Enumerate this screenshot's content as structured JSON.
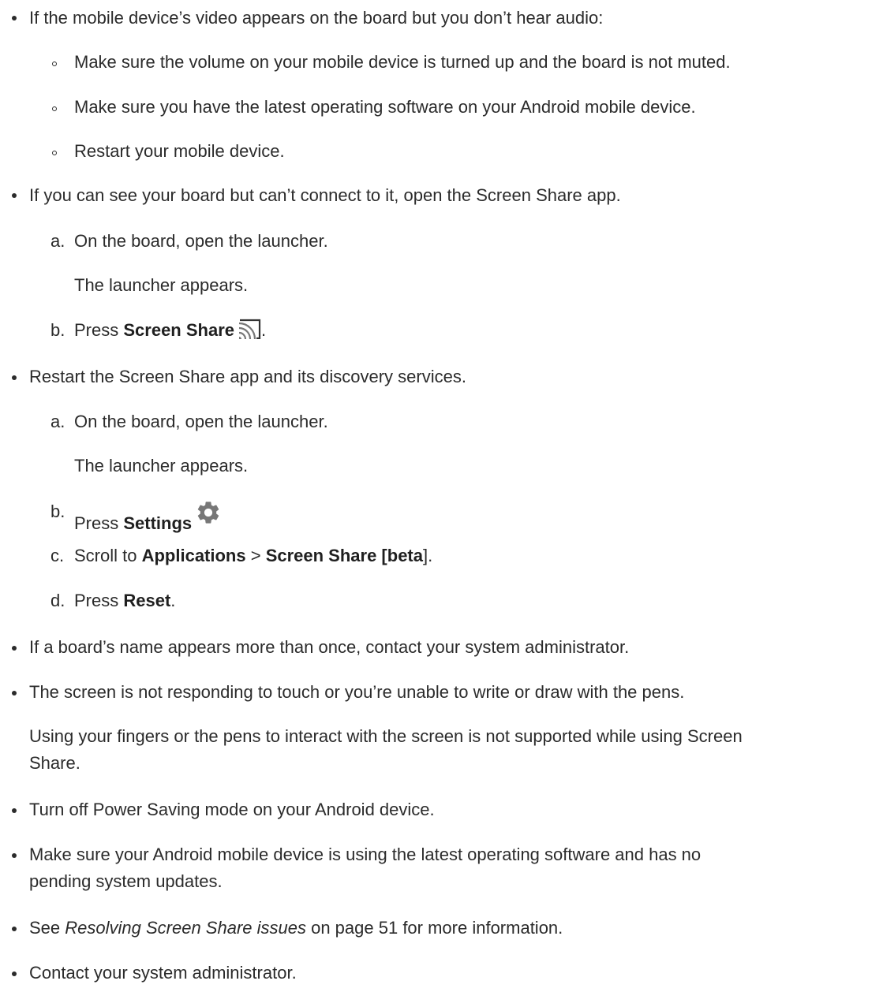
{
  "items": [
    {
      "text": "If the mobile device’s video appears on the board but you don’t hear audio:"
    },
    {
      "text": "Make sure the volume on your mobile device is turned up and the board is not muted."
    },
    {
      "text": "Make sure you have the latest operating software on your Android mobile device."
    },
    {
      "text": "Restart your mobile device."
    },
    {
      "text": "If you can see your board but can’t connect to it, open the Screen Share app."
    },
    {
      "marker": "a.",
      "text": "On the board, open the launcher."
    },
    {
      "text": "The launcher appears."
    },
    {
      "marker": "b.",
      "pre": "Press ",
      "bold": "Screen Share",
      "post": ".",
      "icon": "cast-icon"
    },
    {
      "text": "Restart the Screen Share app and its discovery services."
    },
    {
      "marker": "a.",
      "text": "On the board, open the launcher."
    },
    {
      "text": "The launcher appears."
    },
    {
      "marker": "b.",
      "pre": "Press ",
      "bold": "Settings",
      "icon": "gear-icon"
    },
    {
      "marker": "c.",
      "pre": "Scroll to ",
      "bold1": "Applications",
      "mid": " > ",
      "bold2": "Screen Share [beta",
      "post": "]."
    },
    {
      "marker": "d.",
      "pre": "Press ",
      "bold": "Reset",
      "post": "."
    },
    {
      "text": "If a board’s name appears more than once, contact your system administrator."
    },
    {
      "text": "The screen is not responding to touch or you’re unable to write or draw with the pens."
    },
    {
      "text1": "Using your fingers or the pens to interact with the screen is not supported while using Screen",
      "text2": "Share."
    },
    {
      "text": "Turn off Power Saving mode on your Android device."
    },
    {
      "text1": "Make sure your Android mobile device is using the latest operating software and has no",
      "text2": "pending system updates."
    },
    {
      "pre": "See ",
      "italic": "Resolving Screen Share issues",
      "post": " on page 51 for more information."
    },
    {
      "text": "Contact your system administrator."
    }
  ]
}
